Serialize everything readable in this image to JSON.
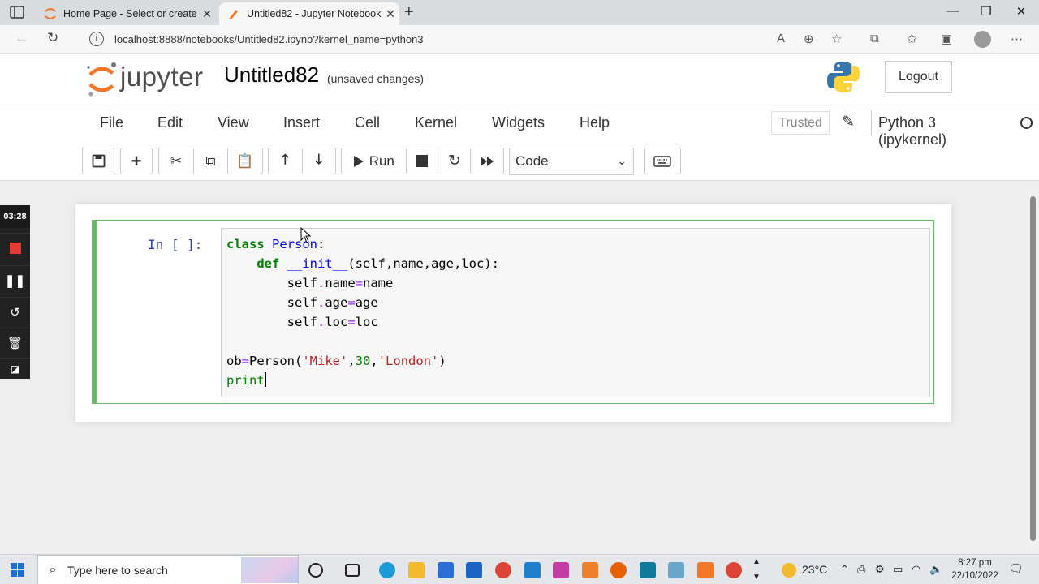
{
  "browser": {
    "tabs": [
      {
        "title": "Home Page - Select or create a n",
        "active": false
      },
      {
        "title": "Untitled82 - Jupyter Notebook",
        "active": true
      }
    ],
    "url": "localhost:8888/notebooks/Untitled82.ipynb?kernel_name=python3"
  },
  "header": {
    "logo_text": "jupyter",
    "notebook_title": "Untitled82",
    "save_status": "(unsaved changes)",
    "logout_label": "Logout"
  },
  "menubar": {
    "items": [
      "File",
      "Edit",
      "View",
      "Insert",
      "Cell",
      "Kernel",
      "Widgets",
      "Help"
    ],
    "trusted_label": "Trusted",
    "kernel_name": "Python 3 (ipykernel)"
  },
  "toolbar": {
    "run_label": "Run",
    "cell_type": "Code"
  },
  "recorder": {
    "time": "03:28"
  },
  "cell": {
    "prompt": "In [ ]:",
    "code_lines": [
      "class Person:",
      "    def __init__(self,name,age,loc):",
      "        self.name=name",
      "        self.age=age",
      "        self.loc=loc",
      "",
      "ob=Person('Mike',30,'London')",
      "print"
    ]
  },
  "taskbar": {
    "search_placeholder": "Type here to search",
    "temperature": "23°C",
    "time": "8:27 pm",
    "date": "22/10/2022"
  },
  "colors": {
    "jupyter_orange": "#f37726",
    "cell_border_green": "#66bb6a",
    "prompt_blue": "#303f9f"
  }
}
